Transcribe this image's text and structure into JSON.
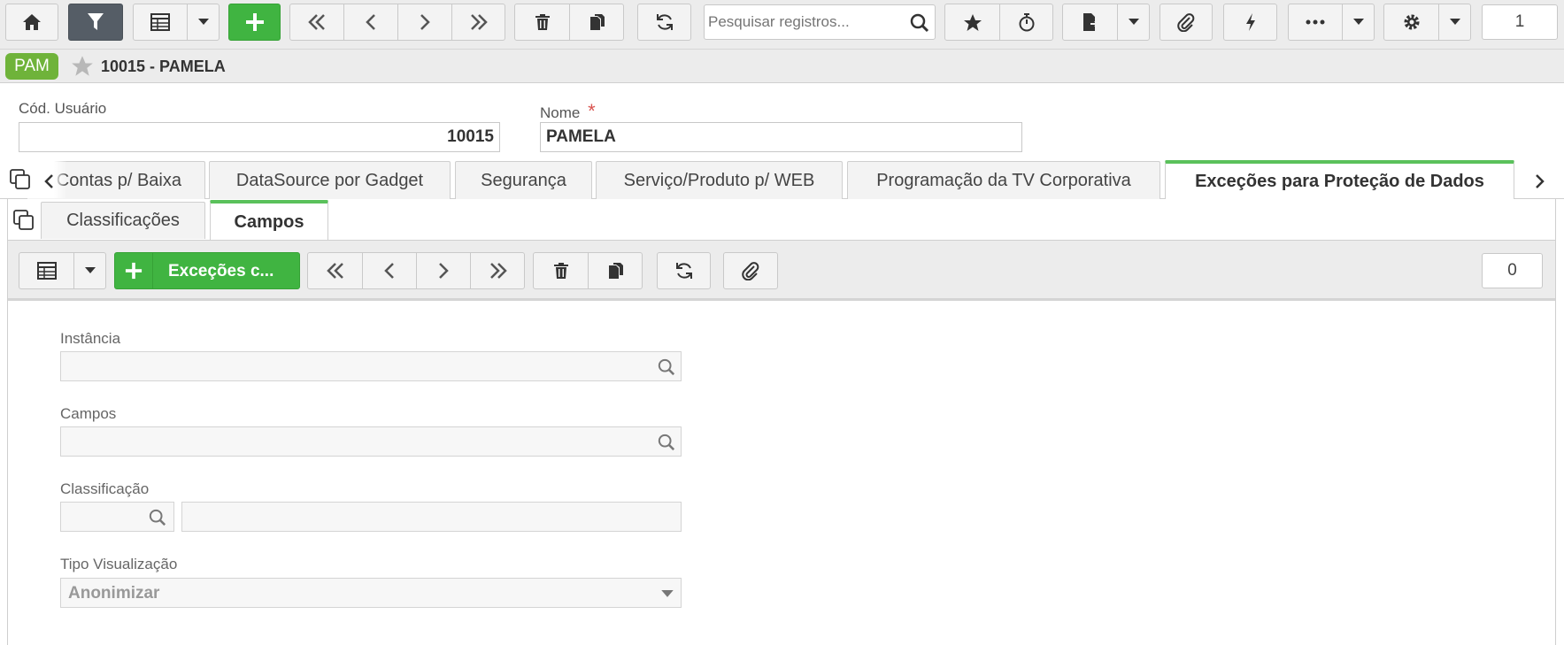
{
  "toolbar": {
    "search_placeholder": "Pesquisar registros...",
    "record_count": "1"
  },
  "title": {
    "badge": "PAM",
    "record_title": "10015 - PAMELA"
  },
  "form": {
    "cod_usuario_label": "Cód. Usuário",
    "cod_usuario_value": "10015",
    "nome_label": "Nome",
    "nome_required": "*",
    "nome_value": "PAMELA"
  },
  "tabs": [
    {
      "label": "Contas p/ Baixa"
    },
    {
      "label": "DataSource por Gadget"
    },
    {
      "label": "Segurança"
    },
    {
      "label": "Serviço/Produto p/ WEB"
    },
    {
      "label": "Programação da TV Corporativa"
    },
    {
      "label": "Exceções para Proteção de Dados"
    }
  ],
  "subtabs": [
    {
      "label": "Classificações"
    },
    {
      "label": "Campos"
    }
  ],
  "subtoolbar": {
    "add_label": "Exceções c...",
    "record_count": "0"
  },
  "detail": {
    "instancia_label": "Instância",
    "campos_label": "Campos",
    "classificacao_label": "Classificação",
    "tipo_label": "Tipo Visualização",
    "tipo_value": "Anonimizar"
  },
  "colors": {
    "accent_green": "#40b441",
    "tab_active_border": "#5ac15b",
    "badge_green": "#6fb33a",
    "required_red": "#d9534f"
  }
}
